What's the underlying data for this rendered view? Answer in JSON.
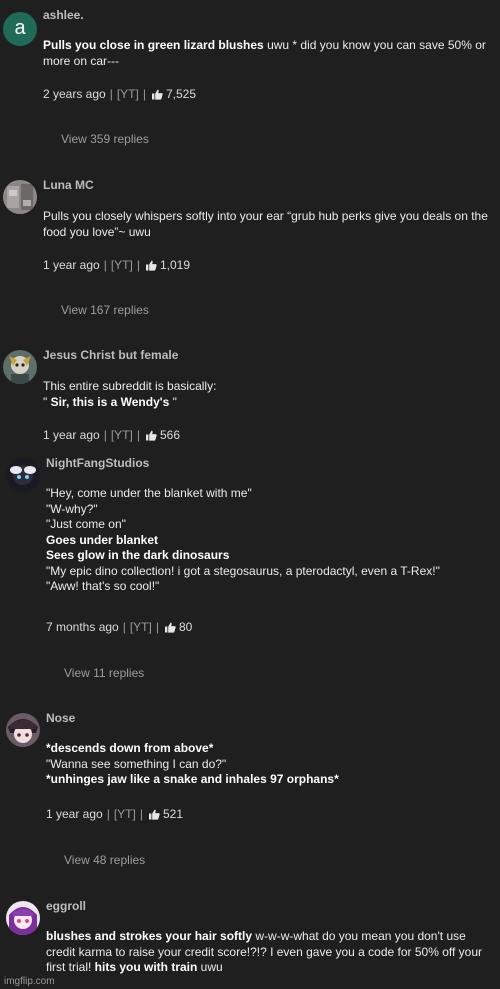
{
  "comments": [
    {
      "username": "ashlee.",
      "avatar_letter": "a",
      "body_bold_1": "Pulls you close in green lizard blushes",
      "body_text_1": " uwu * did you know you can save 50% or more on car---",
      "time": "2 years ago",
      "source": "[YT]",
      "likes": "7,525",
      "replies": "View 359 replies"
    },
    {
      "username": "Luna MC",
      "body_text_1": "Pulls you closely whispers softly into your ear “grub hub perks give you deals on the food you love”~ uwu",
      "time": "1 year ago",
      "source": "[YT]",
      "likes": "1,019",
      "replies": "View 167 replies"
    },
    {
      "username": "Jesus Christ but female",
      "body_text_1": "This entire subreddit is basically:",
      "body_text_2a": "\" ",
      "body_bold_2": "Sir, this is a Wendy's",
      "body_text_2b": " \"",
      "time": "1 year ago",
      "source": "[YT]",
      "likes": "566"
    },
    {
      "username": "NightFangStudios",
      "lines": [
        {
          "text": "\"Hey, come under the blanket with me\"",
          "bold": false
        },
        {
          "text": "\"W-why?\"",
          "bold": false
        },
        {
          "text": "\"Just come on\"",
          "bold": false
        },
        {
          "text": "Goes under blanket",
          "bold": true
        },
        {
          "text": "Sees glow in the dark dinosaurs",
          "bold": true
        },
        {
          "text": "\"My epic dino collection! i got a stegosaurus, a pterodactyl, even a T-Rex!\"",
          "bold": false
        },
        {
          "text": "\"Aww! that's so cool!\"",
          "bold": false
        }
      ],
      "time": "7 months ago",
      "source": "[YT]",
      "likes": "80",
      "replies": "View 11 replies"
    },
    {
      "username": "Nose",
      "lines": [
        {
          "text": "*descends down from above*",
          "bold": true
        },
        {
          "text": "\"Wanna see something I can do?\"",
          "bold": false
        },
        {
          "text": "*unhinges jaw like a snake and inhales 97 orphans*",
          "bold": true
        }
      ],
      "time": "1 year ago",
      "source": "[YT]",
      "likes": "521",
      "replies": "View 48 replies"
    },
    {
      "username": "eggroll",
      "body_bold_1": "blushes and strokes your hair softly",
      "body_text_1": " w-w-w-what do you mean you don't use credit karma to raise your credit score!?!? I even gave you a code for 50% off your first trial! ",
      "body_bold_2": "hits you with train",
      "body_text_2": " uwu"
    }
  ],
  "watermark": "imgflip.com",
  "colors": {
    "background": "#1f1f1f",
    "avatar_a": "#1f6b57"
  },
  "icons": [
    "thumbs-up-icon"
  ]
}
